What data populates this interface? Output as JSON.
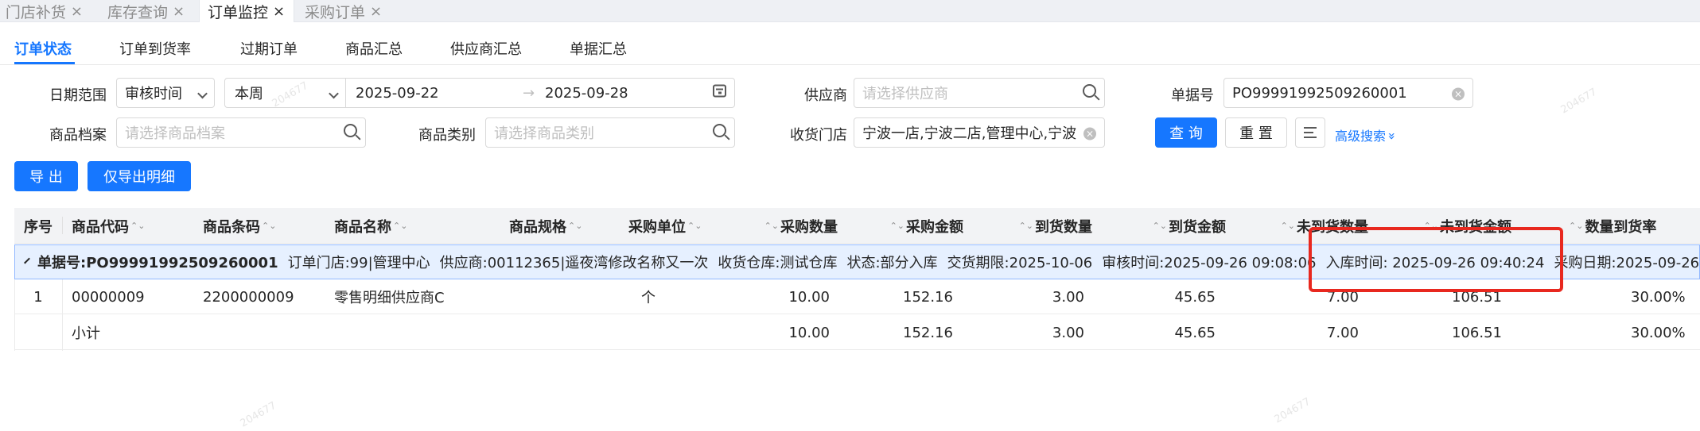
{
  "tabs": [
    {
      "label": "门店补货",
      "close": "×",
      "active": false
    },
    {
      "label": "库存查询",
      "close": "×",
      "active": false
    },
    {
      "label": "订单监控",
      "close": "×",
      "active": true
    },
    {
      "label": "采购订单",
      "close": "×",
      "active": false
    }
  ],
  "subtabs": [
    "订单状态",
    "订单到货率",
    "过期订单",
    "商品汇总",
    "供应商汇总",
    "单据汇总"
  ],
  "filters": {
    "date_range_label": "日期范围",
    "date_type": "审核时间",
    "period": "本周",
    "date_start": "2025-09-22",
    "date_sep": "→",
    "date_end": "2025-09-28",
    "supplier_label": "供应商",
    "supplier_placeholder": "请选择供应商",
    "doc_no_label": "单据号",
    "doc_no_value": "PO99991992509260001",
    "goods_file_label": "商品档案",
    "goods_file_placeholder": "请选择商品档案",
    "goods_cat_label": "商品类别",
    "goods_cat_placeholder": "请选择商品类别",
    "store_label": "收货门店",
    "store_value": "宁波一店,宁波二店,管理中心,宁波三店",
    "clear_glyph": "×",
    "query_btn": "查 询",
    "reset_btn": "重 置",
    "advanced": "高级搜索",
    "advanced_chevron": "»"
  },
  "actions": {
    "export": "导 出",
    "export_detail": "仅导出明细"
  },
  "columns": [
    "序号",
    "商品代码",
    "商品条码",
    "商品名称",
    "商品规格",
    "采购单位",
    "采购数量",
    "采购金额",
    "到货数量",
    "到货金额",
    "未到货数量",
    "未到货金额",
    "数量到货率"
  ],
  "sort_glyph": "⌃⌄",
  "group": {
    "doc": "单据号:PO99991992509260001",
    "store": "订单门店:99|管理中心",
    "supplier": "供应商:00112365|遥夜湾修改名称又一次",
    "warehouse": "收货仓库:测试仓库",
    "status": "状态:部分入库",
    "deadline": "交货期限:2025-10-06",
    "audit_time": "审核时间:2025-09-26 09:08:06",
    "in_time": "入库时间:  2025-09-26 09:40:24",
    "purchase_date": "采购日期:2025-09-26"
  },
  "rows": [
    {
      "no": "1",
      "code": "00000009",
      "barcode": "2200000009",
      "name": "零售明细供应商C",
      "spec": "",
      "unit": "个",
      "qty": "10.00",
      "amount": "152.16",
      "arr_qty": "3.00",
      "arr_amount": "45.65",
      "unarr_qty": "7.00",
      "unarr_amount": "106.51",
      "rate": "30.00%"
    }
  ],
  "subtotal": {
    "label": "小计",
    "qty": "10.00",
    "amount": "152.16",
    "arr_qty": "3.00",
    "arr_amount": "45.65",
    "unarr_qty": "7.00",
    "unarr_amount": "106.51",
    "rate": "30.00%"
  },
  "watermark_text": "204677",
  "colors": {
    "primary": "#1677ff",
    "highlight": "#e8281f",
    "group_bg": "#e6f0ff"
  }
}
